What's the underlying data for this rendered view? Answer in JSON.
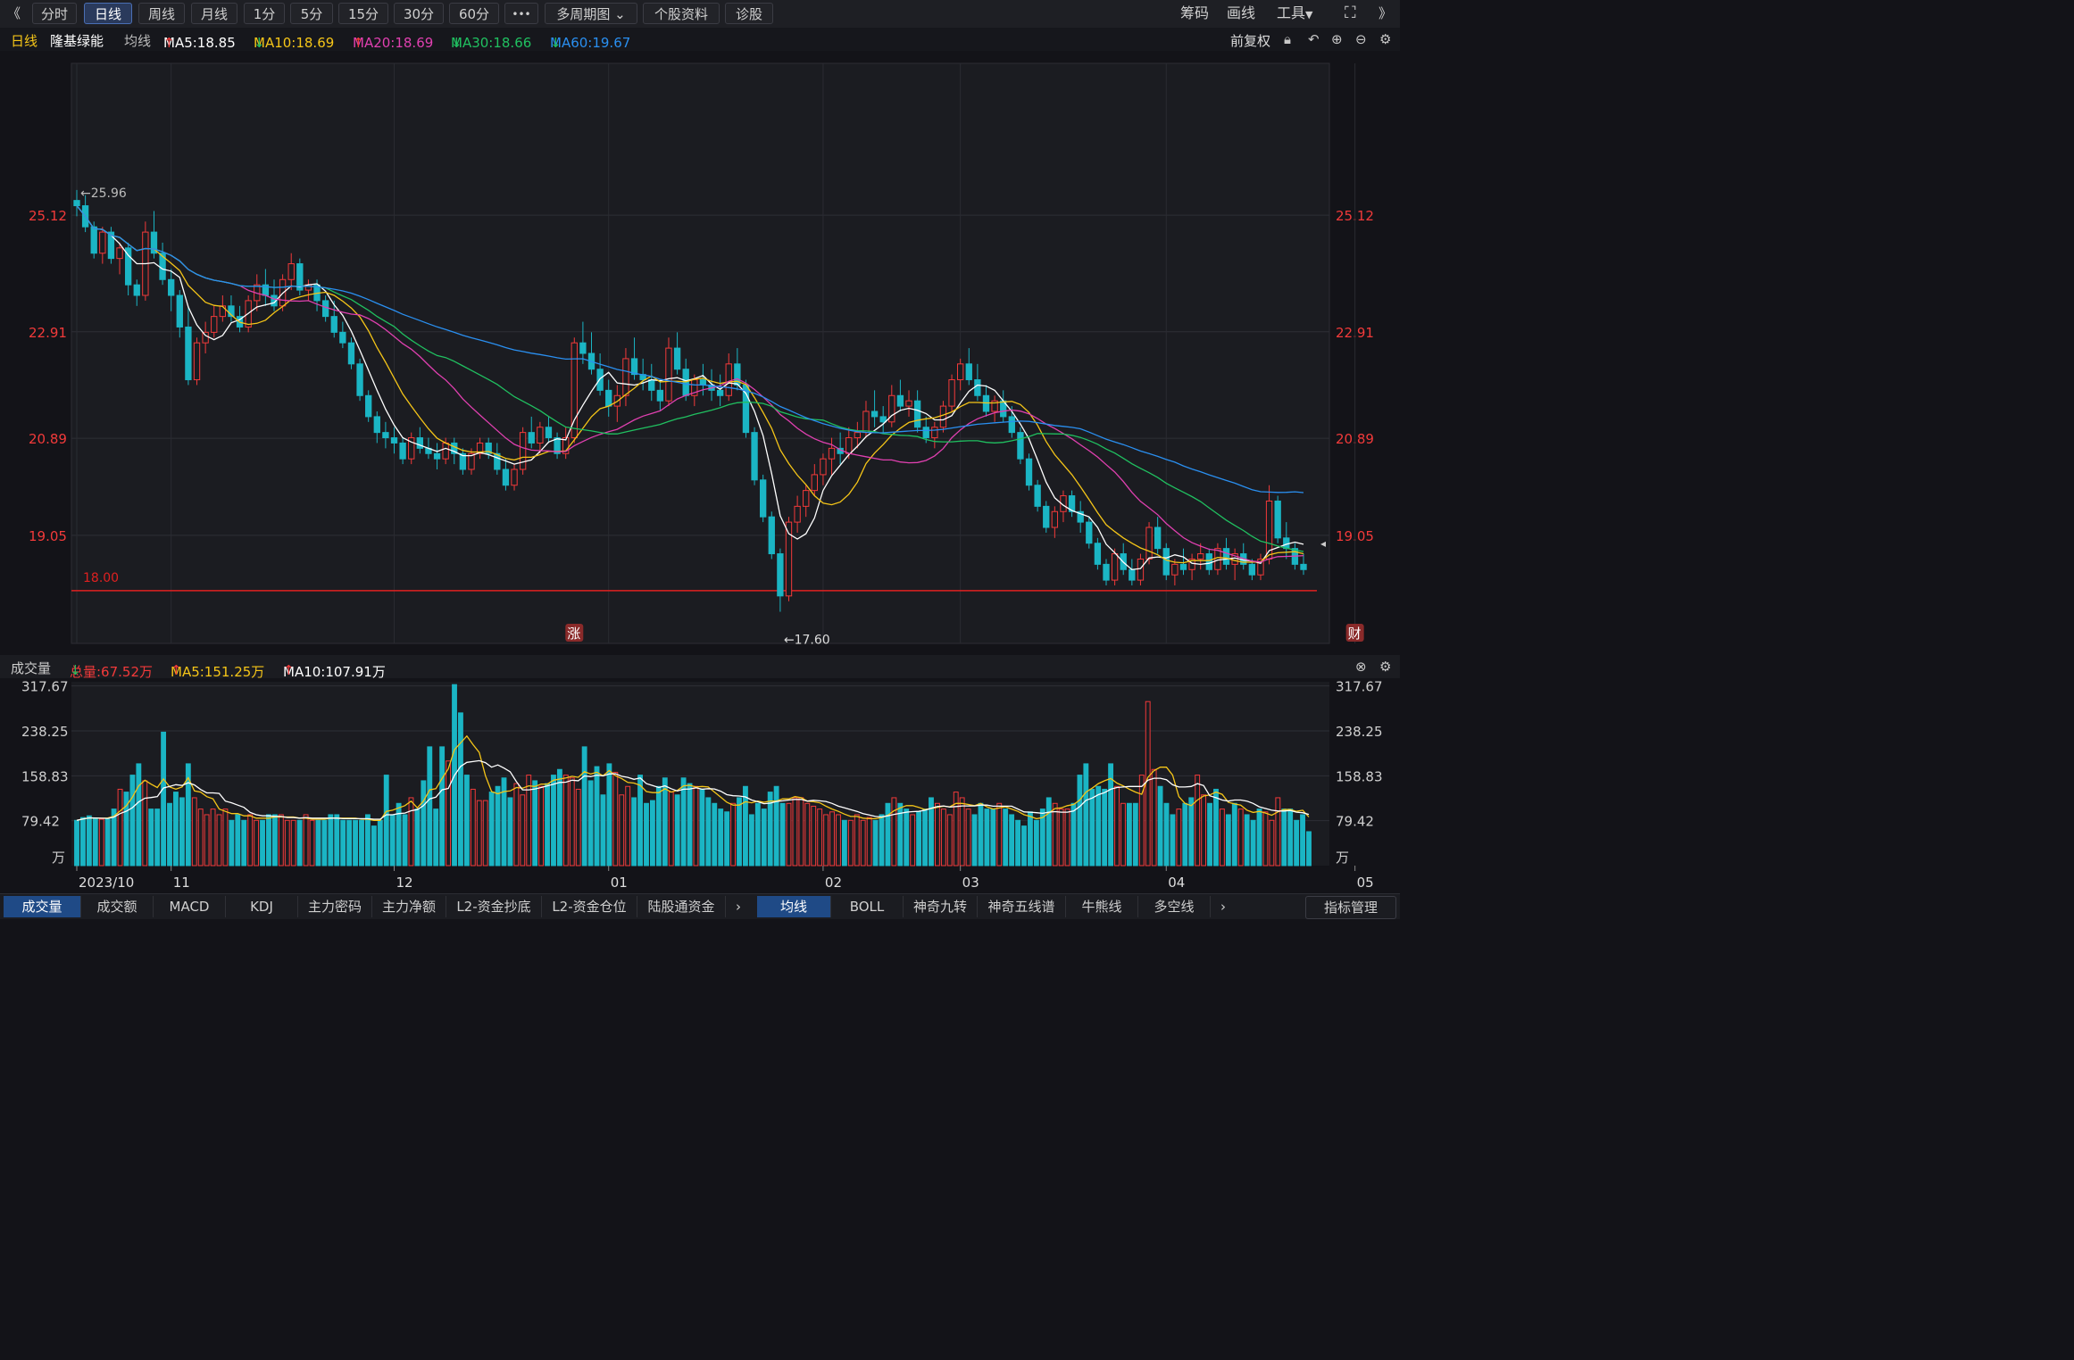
{
  "toolbar": {
    "back": "《",
    "periods": [
      "分时",
      "日线",
      "周线",
      "月线",
      "1分",
      "5分",
      "15分",
      "30分",
      "60分"
    ],
    "active_period": "日线",
    "more": "•••",
    "multi": "多周期图",
    "profile": "个股资料",
    "diagnose": "诊股",
    "right": [
      "筹码",
      "画线",
      "工具"
    ],
    "fullscreen_icon": "fullscreen-icon",
    "collapse": "》"
  },
  "info": {
    "period": "日线",
    "name": "隆基绿能",
    "ma_label": "均线",
    "ma5": "MA5:18.85",
    "ma10": "MA10:18.69",
    "ma20": "MA20:18.69",
    "ma30": "MA30:18.66",
    "ma60": "MA60:19.67",
    "adjust": "前复权",
    "colors": {
      "up": "#f23a3a",
      "down": "#1bb5c4",
      "ma5": "#ffffff",
      "ma10": "#f5c518",
      "ma20": "#e040b0",
      "ma30": "#20c060",
      "ma60": "#2a8ff0",
      "ref": "#e02020"
    }
  },
  "volume": {
    "title": "成交量",
    "total": "总量:67.52万",
    "ma5": "MA5:151.25万",
    "ma10": "MA10:107.91万"
  },
  "bottom": {
    "tabs": [
      "成交量",
      "成交额",
      "MACD",
      "KDJ",
      "主力密码",
      "主力净额",
      "L2-资金抄底",
      "L2-资金仓位",
      "陆股通资金"
    ],
    "tabs2": [
      "均线",
      "BOLL",
      "神奇九转",
      "神奇五线谱",
      "牛熊线",
      "多空线"
    ],
    "right": "指标管理"
  },
  "chart_data": [
    {
      "type": "candlestick",
      "title": "隆基绿能 日线",
      "y_ticks": [
        "25.12",
        "22.91",
        "20.89",
        "19.05"
      ],
      "y_tick_values": [
        25.12,
        22.91,
        20.89,
        19.05
      ],
      "ylim": [
        17.0,
        28.0
      ],
      "reference_line": {
        "value": 18.0,
        "label": "18.00"
      },
      "annotations": {
        "high": "←25.96",
        "low": "←17.60",
        "markers": [
          "涨",
          "财"
        ]
      },
      "x_labels": [
        "2023/10",
        "11",
        "12",
        "01",
        "02",
        "03",
        "04",
        "05"
      ],
      "x_label_index": [
        0,
        11,
        37,
        62,
        87,
        103,
        127,
        149
      ],
      "ohlc": [
        [
          25.4,
          25.6,
          25.1,
          25.3
        ],
        [
          25.3,
          25.5,
          24.8,
          24.9
        ],
        [
          24.9,
          25.0,
          24.3,
          24.4
        ],
        [
          24.4,
          24.9,
          24.2,
          24.8
        ],
        [
          24.8,
          24.9,
          24.2,
          24.3
        ],
        [
          24.3,
          24.6,
          24.0,
          24.5
        ],
        [
          24.5,
          24.6,
          23.6,
          23.8
        ],
        [
          23.8,
          23.9,
          23.4,
          23.6
        ],
        [
          23.6,
          25.0,
          23.5,
          24.8
        ],
        [
          24.8,
          25.2,
          24.3,
          24.4
        ],
        [
          24.4,
          24.6,
          23.8,
          23.9
        ],
        [
          23.9,
          24.1,
          23.3,
          23.6
        ],
        [
          23.6,
          23.7,
          22.8,
          23.0
        ],
        [
          23.0,
          23.4,
          21.9,
          22.0
        ],
        [
          22.0,
          22.8,
          21.9,
          22.7
        ],
        [
          22.7,
          23.1,
          22.5,
          22.9
        ],
        [
          22.9,
          23.4,
          22.8,
          23.2
        ],
        [
          23.2,
          23.6,
          23.1,
          23.4
        ],
        [
          23.4,
          23.6,
          23.1,
          23.2
        ],
        [
          23.2,
          23.4,
          22.9,
          23.0
        ],
        [
          23.0,
          23.6,
          22.9,
          23.5
        ],
        [
          23.5,
          24.0,
          23.3,
          23.8
        ],
        [
          23.8,
          24.1,
          23.4,
          23.6
        ],
        [
          23.6,
          23.9,
          23.3,
          23.4
        ],
        [
          23.4,
          24.0,
          23.3,
          23.9
        ],
        [
          23.9,
          24.4,
          23.7,
          24.2
        ],
        [
          24.2,
          24.3,
          23.6,
          23.7
        ],
        [
          23.7,
          23.9,
          23.5,
          23.8
        ],
        [
          23.8,
          23.9,
          23.3,
          23.5
        ],
        [
          23.5,
          23.6,
          23.1,
          23.2
        ],
        [
          23.2,
          23.5,
          22.8,
          22.9
        ],
        [
          22.9,
          23.1,
          22.6,
          22.7
        ],
        [
          22.7,
          22.8,
          22.2,
          22.3
        ],
        [
          22.3,
          22.4,
          21.6,
          21.7
        ],
        [
          21.7,
          21.8,
          21.2,
          21.3
        ],
        [
          21.3,
          21.4,
          20.8,
          21.0
        ],
        [
          21.0,
          21.2,
          20.7,
          20.9
        ],
        [
          20.9,
          21.1,
          20.6,
          20.8
        ],
        [
          20.8,
          20.9,
          20.4,
          20.5
        ],
        [
          20.5,
          21.0,
          20.4,
          20.9
        ],
        [
          20.9,
          21.1,
          20.6,
          20.7
        ],
        [
          20.7,
          20.9,
          20.5,
          20.6
        ],
        [
          20.6,
          20.8,
          20.3,
          20.5
        ],
        [
          20.5,
          20.9,
          20.4,
          20.8
        ],
        [
          20.8,
          20.9,
          20.4,
          20.6
        ],
        [
          20.6,
          20.7,
          20.2,
          20.3
        ],
        [
          20.3,
          20.7,
          20.2,
          20.6
        ],
        [
          20.6,
          20.9,
          20.5,
          20.8
        ],
        [
          20.8,
          20.9,
          20.5,
          20.6
        ],
        [
          20.6,
          20.8,
          20.2,
          20.3
        ],
        [
          20.3,
          20.5,
          19.9,
          20.0
        ],
        [
          20.0,
          20.4,
          19.9,
          20.3
        ],
        [
          20.3,
          21.1,
          20.2,
          21.0
        ],
        [
          21.0,
          21.3,
          20.7,
          20.8
        ],
        [
          20.8,
          21.2,
          20.6,
          21.1
        ],
        [
          21.1,
          21.3,
          20.8,
          20.9
        ],
        [
          20.9,
          21.0,
          20.5,
          20.6
        ],
        [
          20.6,
          21.1,
          20.5,
          20.9
        ],
        [
          20.9,
          22.8,
          20.8,
          22.7
        ],
        [
          22.7,
          23.1,
          22.3,
          22.5
        ],
        [
          22.5,
          22.9,
          22.1,
          22.2
        ],
        [
          22.2,
          22.5,
          21.7,
          21.8
        ],
        [
          21.8,
          22.0,
          21.3,
          21.5
        ],
        [
          21.5,
          21.9,
          21.2,
          21.7
        ],
        [
          21.7,
          22.6,
          21.5,
          22.4
        ],
        [
          22.4,
          22.8,
          22.0,
          22.1
        ],
        [
          22.1,
          22.4,
          21.8,
          22.0
        ],
        [
          22.0,
          22.3,
          21.6,
          21.8
        ],
        [
          21.8,
          22.0,
          21.4,
          21.6
        ],
        [
          21.6,
          22.8,
          21.5,
          22.6
        ],
        [
          22.6,
          22.9,
          22.1,
          22.2
        ],
        [
          22.2,
          22.4,
          21.6,
          21.7
        ],
        [
          21.7,
          22.1,
          21.5,
          22.0
        ],
        [
          22.0,
          22.3,
          21.7,
          21.9
        ],
        [
          21.9,
          22.2,
          21.6,
          21.8
        ],
        [
          21.8,
          22.1,
          21.5,
          21.7
        ],
        [
          21.7,
          22.5,
          21.6,
          22.3
        ],
        [
          22.3,
          22.6,
          21.8,
          21.9
        ],
        [
          21.9,
          22.0,
          20.9,
          21.0
        ],
        [
          21.0,
          21.1,
          20.0,
          20.1
        ],
        [
          20.1,
          20.2,
          19.3,
          19.4
        ],
        [
          19.4,
          19.5,
          18.6,
          18.7
        ],
        [
          18.7,
          18.8,
          17.6,
          17.9
        ],
        [
          17.9,
          19.4,
          17.8,
          19.3
        ],
        [
          19.3,
          19.8,
          19.1,
          19.6
        ],
        [
          19.6,
          20.0,
          19.4,
          19.9
        ],
        [
          19.9,
          20.4,
          19.8,
          20.2
        ],
        [
          20.2,
          20.6,
          20.0,
          20.5
        ],
        [
          20.5,
          20.9,
          20.2,
          20.7
        ],
        [
          20.7,
          21.0,
          20.4,
          20.6
        ],
        [
          20.6,
          21.1,
          20.5,
          20.9
        ],
        [
          20.9,
          21.2,
          20.7,
          21.0
        ],
        [
          21.0,
          21.6,
          20.9,
          21.4
        ],
        [
          21.4,
          21.8,
          21.1,
          21.3
        ],
        [
          21.3,
          21.5,
          21.0,
          21.2
        ],
        [
          21.2,
          21.9,
          21.1,
          21.7
        ],
        [
          21.7,
          22.0,
          21.4,
          21.5
        ],
        [
          21.5,
          21.8,
          21.3,
          21.6
        ],
        [
          21.6,
          21.8,
          21.0,
          21.1
        ],
        [
          21.1,
          21.3,
          20.8,
          20.9
        ],
        [
          20.9,
          21.2,
          20.7,
          21.1
        ],
        [
          21.1,
          21.6,
          21.0,
          21.5
        ],
        [
          21.5,
          22.1,
          21.4,
          22.0
        ],
        [
          22.0,
          22.4,
          21.8,
          22.3
        ],
        [
          22.3,
          22.6,
          21.9,
          22.0
        ],
        [
          22.0,
          22.3,
          21.6,
          21.7
        ],
        [
          21.7,
          21.9,
          21.3,
          21.4
        ],
        [
          21.4,
          21.7,
          21.2,
          21.6
        ],
        [
          21.6,
          21.8,
          21.2,
          21.3
        ],
        [
          21.3,
          21.5,
          20.9,
          21.0
        ],
        [
          21.0,
          21.1,
          20.4,
          20.5
        ],
        [
          20.5,
          20.6,
          19.9,
          20.0
        ],
        [
          20.0,
          20.1,
          19.5,
          19.6
        ],
        [
          19.6,
          19.7,
          19.1,
          19.2
        ],
        [
          19.2,
          19.6,
          19.0,
          19.5
        ],
        [
          19.5,
          19.9,
          19.3,
          19.8
        ],
        [
          19.8,
          19.9,
          19.4,
          19.5
        ],
        [
          19.5,
          19.7,
          19.1,
          19.3
        ],
        [
          19.3,
          19.4,
          18.8,
          18.9
        ],
        [
          18.9,
          19.0,
          18.4,
          18.5
        ],
        [
          18.5,
          18.6,
          18.1,
          18.2
        ],
        [
          18.2,
          18.8,
          18.1,
          18.7
        ],
        [
          18.7,
          18.9,
          18.3,
          18.4
        ],
        [
          18.4,
          18.6,
          18.1,
          18.2
        ],
        [
          18.2,
          18.7,
          18.1,
          18.6
        ],
        [
          18.6,
          19.3,
          18.5,
          19.2
        ],
        [
          19.2,
          19.4,
          18.7,
          18.8
        ],
        [
          18.8,
          18.9,
          18.2,
          18.3
        ],
        [
          18.3,
          18.6,
          18.1,
          18.5
        ],
        [
          18.5,
          18.8,
          18.3,
          18.4
        ],
        [
          18.4,
          18.7,
          18.2,
          18.6
        ],
        [
          18.6,
          18.9,
          18.4,
          18.7
        ],
        [
          18.7,
          18.8,
          18.3,
          18.4
        ],
        [
          18.4,
          18.9,
          18.3,
          18.8
        ],
        [
          18.8,
          19.0,
          18.4,
          18.5
        ],
        [
          18.5,
          18.8,
          18.2,
          18.7
        ],
        [
          18.7,
          18.9,
          18.4,
          18.5
        ],
        [
          18.5,
          18.6,
          18.2,
          18.3
        ],
        [
          18.3,
          18.7,
          18.2,
          18.6
        ],
        [
          18.6,
          20.0,
          18.5,
          19.7
        ],
        [
          19.7,
          19.8,
          18.9,
          19.0
        ],
        [
          19.0,
          19.3,
          18.6,
          18.8
        ],
        [
          18.8,
          18.9,
          18.4,
          18.5
        ],
        [
          18.5,
          18.7,
          18.3,
          18.4
        ]
      ]
    },
    {
      "type": "bar",
      "title": "成交量",
      "unit": "万",
      "y_ticks": [
        "317.67",
        "238.25",
        "158.83",
        "79.42"
      ],
      "y_tick_values": [
        317.67,
        238.25,
        158.83,
        79.42
      ],
      "ylim": [
        0,
        325
      ],
      "values": [
        80,
        85,
        88,
        84,
        82,
        82,
        100,
        135,
        130,
        160,
        180,
        150,
        100,
        100,
        236,
        110,
        130,
        120,
        180,
        120,
        100,
        90,
        100,
        90,
        100,
        80,
        90,
        80,
        90,
        80,
        80,
        90,
        90,
        90,
        80,
        80,
        80,
        90,
        80,
        80,
        80,
        90,
        90,
        80,
        80,
        80,
        80,
        90,
        70,
        80,
        160,
        90,
        110,
        90,
        120,
        100,
        150,
        210,
        100,
        210,
        185,
        320,
        270,
        160,
        135,
        115,
        115,
        130,
        140,
        155,
        120,
        145,
        125,
        160,
        150,
        140,
        145,
        160,
        170,
        160,
        155,
        135,
        210,
        150,
        175,
        125,
        180,
        165,
        125,
        140,
        120,
        160,
        110,
        115,
        140,
        155,
        130,
        125,
        155,
        145,
        140,
        135,
        120,
        110,
        100,
        95,
        110,
        120,
        140,
        90,
        110,
        100,
        130,
        140,
        110,
        110,
        120,
        120,
        110,
        105,
        100,
        90,
        95,
        90,
        80,
        80,
        90,
        80,
        85,
        80,
        90,
        110,
        120,
        110,
        100,
        90,
        95,
        100,
        120,
        110,
        100,
        90,
        130,
        120,
        100,
        90,
        110,
        100,
        100,
        110,
        100,
        90,
        80,
        70,
        95,
        80,
        100,
        120,
        110,
        100,
        100,
        110,
        160,
        180,
        135,
        140,
        135,
        180,
        140,
        110,
        110,
        110,
        160,
        290,
        170,
        140,
        110,
        90,
        100,
        110,
        120,
        160,
        125,
        110,
        135,
        100,
        90,
        110,
        100,
        90,
        80,
        100,
        95,
        80,
        120,
        100,
        100,
        80,
        90,
        60
      ]
    }
  ]
}
